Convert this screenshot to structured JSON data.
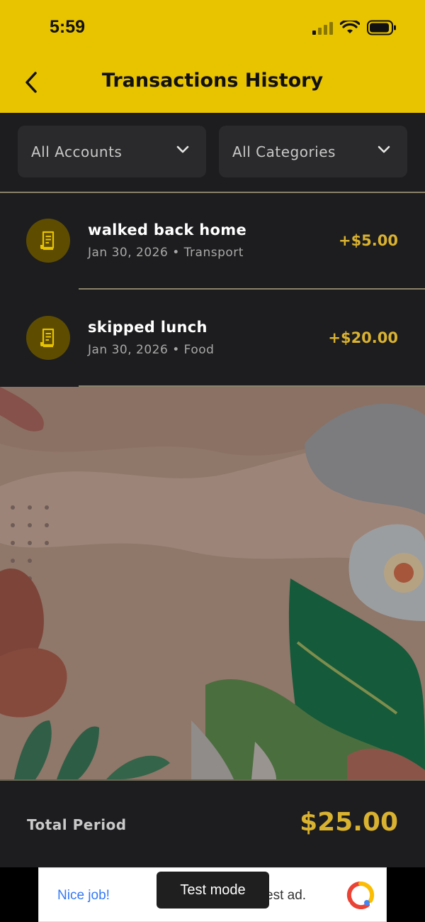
{
  "status_bar": {
    "time": "5:59"
  },
  "header": {
    "title": "Transactions History"
  },
  "filters": {
    "accounts": "All Accounts",
    "categories": "All Categories"
  },
  "transactions": [
    {
      "title": "walked back home",
      "subtitle": "Jan 30, 2026 • Transport",
      "amount": "+$5.00",
      "icon": "receipt-icon"
    },
    {
      "title": "skipped lunch",
      "subtitle": "Jan 30, 2026 • Food",
      "amount": "+$20.00",
      "icon": "receipt-icon"
    }
  ],
  "total": {
    "label": "Total Period",
    "amount": "$25.00"
  },
  "ad": {
    "nice": "Nice job!",
    "text": "est ad.",
    "tooltip": "Test mode"
  },
  "colors": {
    "accent": "#e8c300",
    "amount": "#d9b230",
    "surface": "#1d1d1f",
    "control": "#2a2a2c"
  }
}
